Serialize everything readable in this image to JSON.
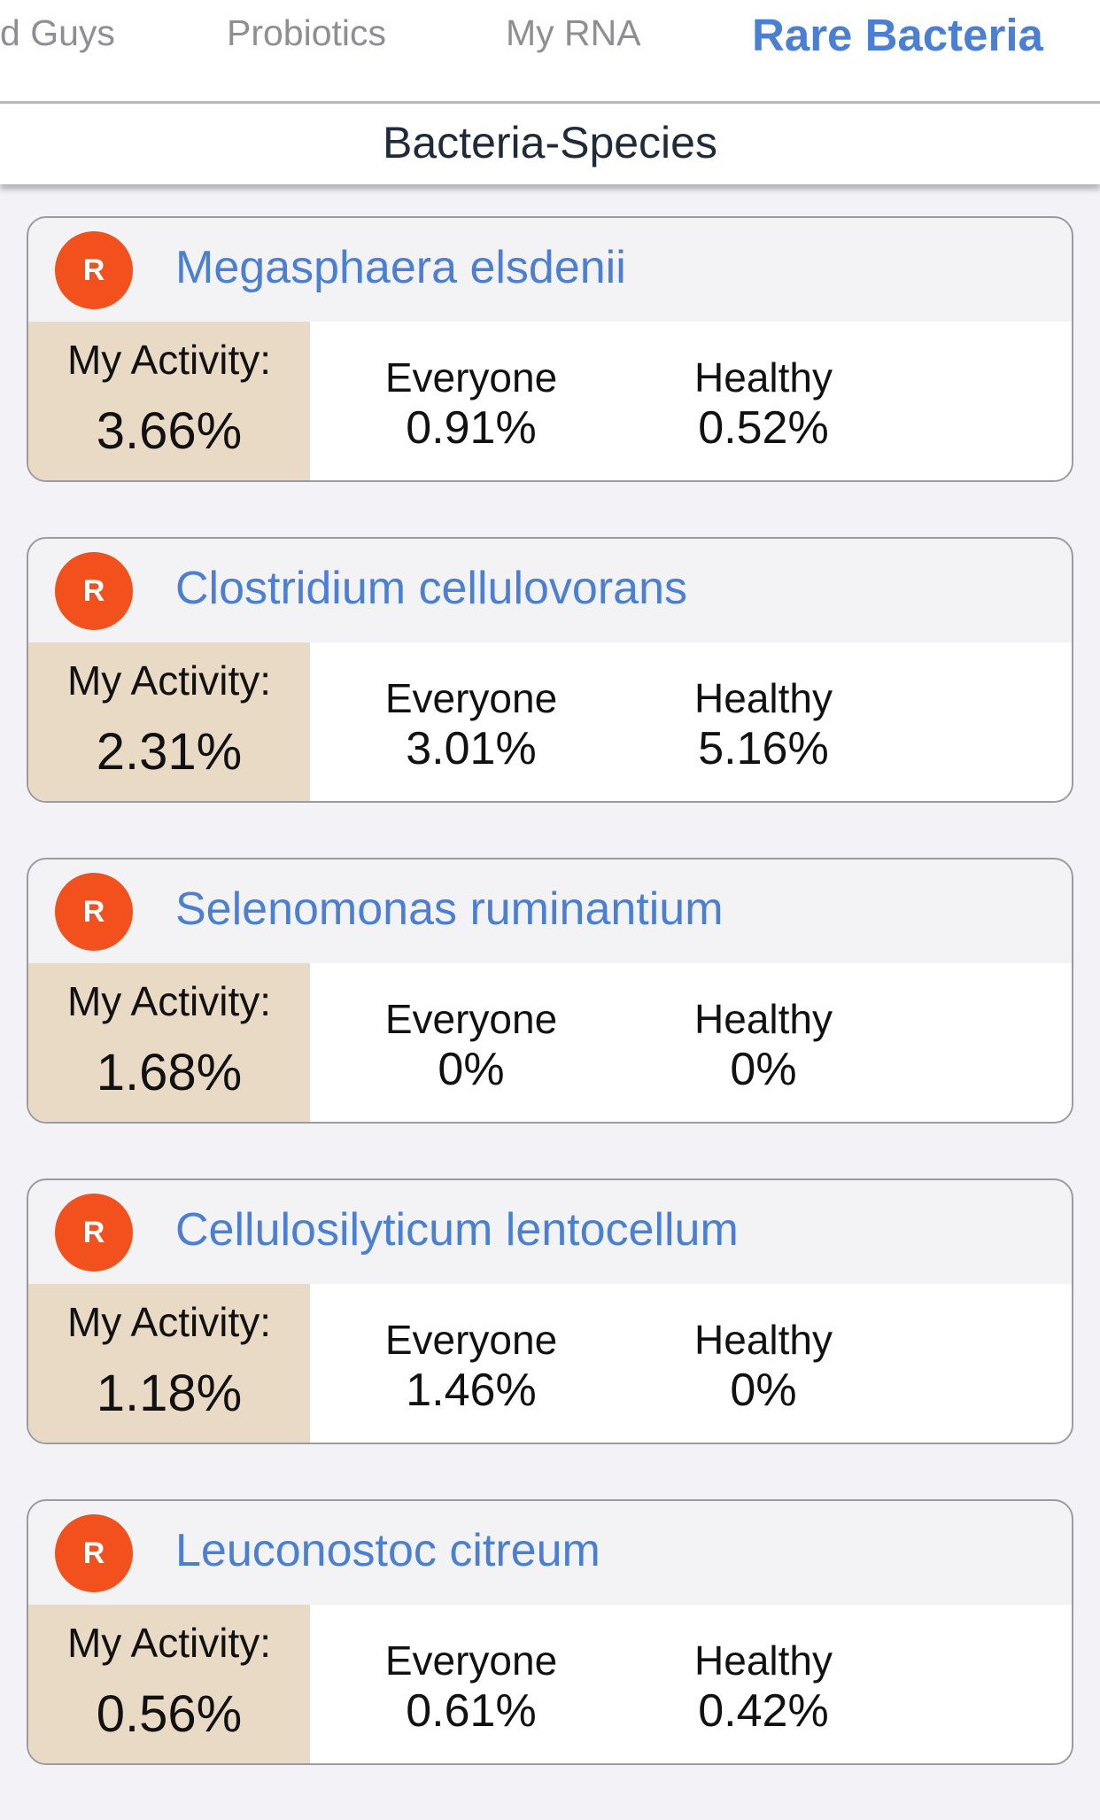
{
  "tabs": [
    {
      "label": "d Guys",
      "active": false
    },
    {
      "label": "Probiotics",
      "active": false
    },
    {
      "label": "My RNA",
      "active": false
    },
    {
      "label": "Rare Bacteria",
      "active": true
    }
  ],
  "subheader": {
    "title": "Bacteria-Species"
  },
  "colors": {
    "accent": "#4a7fd3",
    "badge": "#f2501c",
    "my_activity_bg": "#e9dac6"
  },
  "labels": {
    "my_activity": "My Activity:",
    "everyone": "Everyone",
    "healthy": "Healthy"
  },
  "species": [
    {
      "badge": "R",
      "name": "Megasphaera elsdenii",
      "my_activity": "3.66%",
      "everyone": "0.91%",
      "healthy": "0.52%"
    },
    {
      "badge": "R",
      "name": "Clostridium cellulovorans",
      "my_activity": "2.31%",
      "everyone": "3.01%",
      "healthy": "5.16%"
    },
    {
      "badge": "R",
      "name": "Selenomonas ruminantium",
      "my_activity": "1.68%",
      "everyone": "0%",
      "healthy": "0%"
    },
    {
      "badge": "R",
      "name": "Cellulosilyticum lentocellum",
      "my_activity": "1.18%",
      "everyone": "1.46%",
      "healthy": "0%"
    },
    {
      "badge": "R",
      "name": "Leuconostoc citreum",
      "my_activity": "0.56%",
      "everyone": "0.61%",
      "healthy": "0.42%"
    }
  ]
}
